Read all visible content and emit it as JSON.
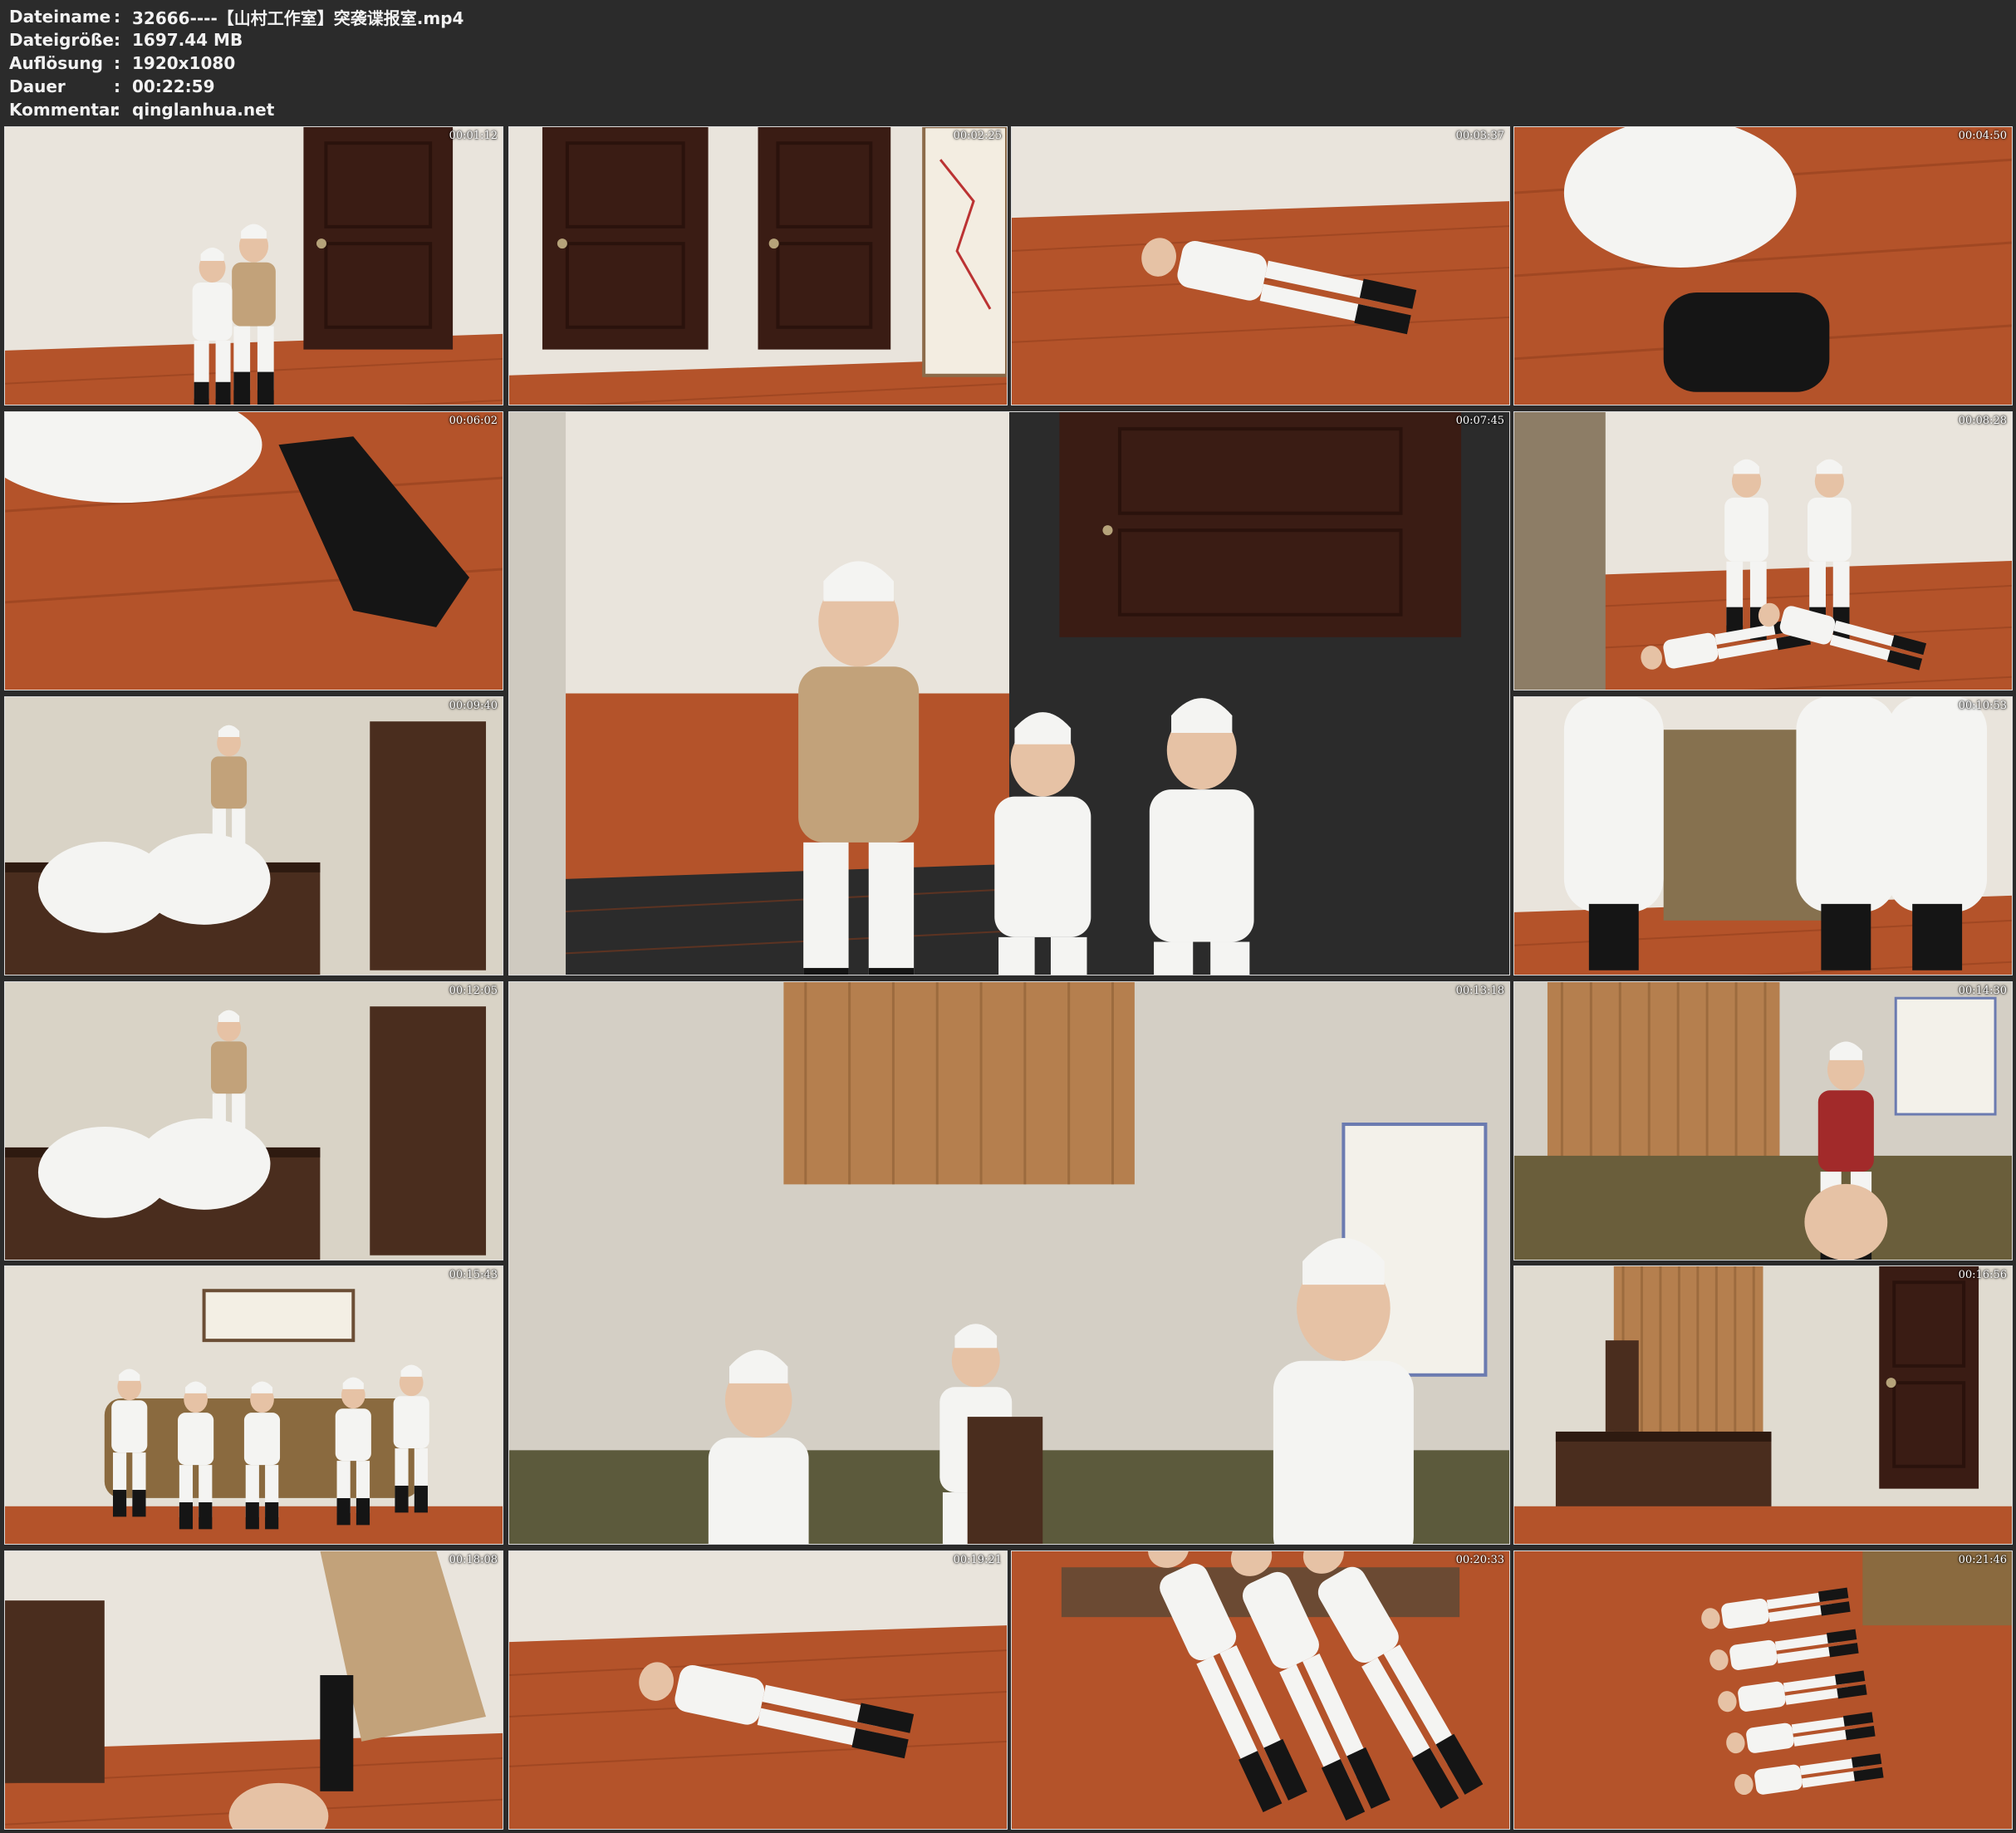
{
  "info": {
    "filename_label": "Dateiname",
    "filename": "32666----【山村工作室】突袭谍报室.mp4",
    "filesize_label": "Dateigröße",
    "filesize": "1697.44 MB",
    "resolution_label": "Auflösung",
    "resolution": "1920x1080",
    "duration_label": "Dauer",
    "duration": "00:22:59",
    "comment_label": "Kommentar",
    "comment": "qinglanhua.net",
    "separator": ":"
  },
  "thumbnails": [
    {
      "timestamp": "00:01:12",
      "scene": "door-room"
    },
    {
      "timestamp": "00:02:25",
      "scene": "doors-map"
    },
    {
      "timestamp": "00:03:37",
      "scene": "floor-lying"
    },
    {
      "timestamp": "00:04:50",
      "scene": "floor-closeup"
    },
    {
      "timestamp": "00:06:02",
      "scene": "floor-boots"
    },
    {
      "timestamp": "00:07:45",
      "scene": "door-large"
    },
    {
      "timestamp": "00:08:28",
      "scene": "wall-seated"
    },
    {
      "timestamp": "00:09:40",
      "scene": "office-desk"
    },
    {
      "timestamp": "00:10:53",
      "scene": "standing-legs"
    },
    {
      "timestamp": "00:12:05",
      "scene": "office-desk"
    },
    {
      "timestamp": "00:13:18",
      "scene": "office-large"
    },
    {
      "timestamp": "00:14:30",
      "scene": "curtain-room"
    },
    {
      "timestamp": "00:15:43",
      "scene": "sofa-group"
    },
    {
      "timestamp": "00:16:56",
      "scene": "office-wide"
    },
    {
      "timestamp": "00:18:08",
      "scene": "floor-coat"
    },
    {
      "timestamp": "00:19:21",
      "scene": "floor-lying"
    },
    {
      "timestamp": "00:20:33",
      "scene": "floor-blur"
    },
    {
      "timestamp": "00:21:46",
      "scene": "floor-row"
    }
  ],
  "scene_colors": {
    "wall": "#e9e4dc",
    "floor": "#b4532a",
    "door": "#3a1c14",
    "curtain": "#b57f4e",
    "uniform": "#f4f4f2",
    "coat": "#c2a27a",
    "boot": "#151515",
    "furniture": "#4a2d1e"
  }
}
